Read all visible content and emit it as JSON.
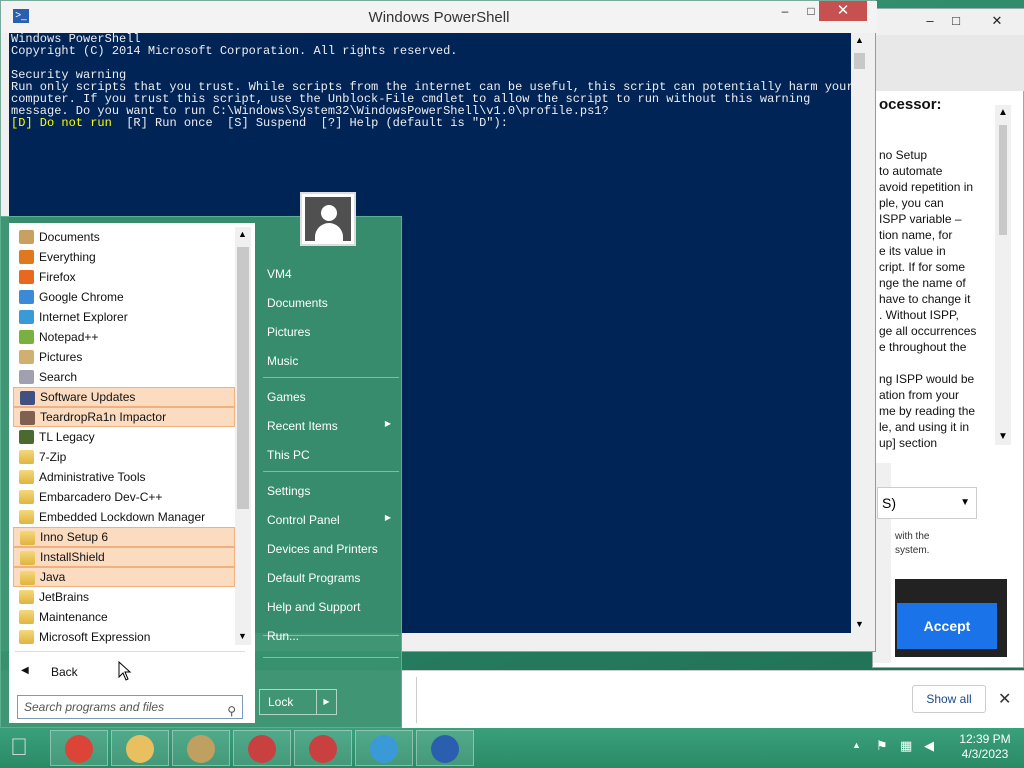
{
  "powershell": {
    "title": "Windows PowerShell",
    "icon": "powershell-icon",
    "lines": [
      "Windows PowerShell",
      "Copyright (C) 2014 Microsoft Corporation. All rights reserved.",
      "",
      "Security warning",
      "Run only scripts that you trust. While scripts from the internet can be useful, this script can potentially harm your",
      "computer. If you trust this script, use the Unblock-File cmdlet to allow the script to run without this warning",
      "message. Do you want to run C:\\Windows\\System32\\WindowsPowerShell\\v1.0\\profile.ps1?"
    ],
    "prompt_highlight": "[D] Do not run",
    "prompt_rest": "  [R] Run once  [S] Suspend  [?] Help (default is \"D\"):",
    "minimize": "–",
    "maximize": "□",
    "close": "✕"
  },
  "browser": {
    "minimize": "–",
    "maximize": "□",
    "close": "✕",
    "heading": "ocessor:",
    "article_lines": [
      "no Setup",
      "to automate",
      "avoid repetition in",
      "ple, you can",
      "ISPP variable –",
      "tion name, for",
      "e its value in",
      "cript. If for some",
      "nge the name of",
      "have to change it",
      ". Without ISPP,",
      "ge all occurrences",
      "e throughout the",
      "",
      "ng ISPP would be",
      "ation from your",
      "me by reading the",
      "le, and using it in",
      "up] section"
    ],
    "select_value": "S)",
    "small_text_1": "with the",
    "small_text_2": "system.",
    "accept_label": "Accept"
  },
  "download_bar": {
    "show_all": "Show all",
    "close": "✕"
  },
  "start_menu": {
    "programs": [
      {
        "label": "Documents",
        "icon": "documents-icon",
        "color": "#c8a060",
        "highlight": false
      },
      {
        "label": "Everything",
        "icon": "everything-icon",
        "color": "#e07820",
        "highlight": false
      },
      {
        "label": "Firefox",
        "icon": "firefox-icon",
        "color": "#e86820",
        "highlight": false
      },
      {
        "label": "Google Chrome",
        "icon": "chrome-icon",
        "color": "#3a8ad8",
        "highlight": false
      },
      {
        "label": "Internet Explorer",
        "icon": "ie-icon",
        "color": "#3a9ad8",
        "highlight": false
      },
      {
        "label": "Notepad++",
        "icon": "notepadpp-icon",
        "color": "#7ab040",
        "highlight": false
      },
      {
        "label": "Pictures",
        "icon": "pictures-icon",
        "color": "#d0b070",
        "highlight": false
      },
      {
        "label": "Search",
        "icon": "search-icon",
        "color": "#a0a0b0",
        "highlight": false
      },
      {
        "label": "Software Updates",
        "icon": "software-updates-icon",
        "color": "#405080",
        "highlight": true
      },
      {
        "label": "TeardropRa1n Impactor",
        "icon": "impactor-icon",
        "color": "#806050",
        "highlight": true
      },
      {
        "label": "TL Legacy",
        "icon": "tl-legacy-icon",
        "color": "#4a6a30",
        "highlight": false
      },
      {
        "label": "7-Zip",
        "icon": "folder-icon",
        "color": "folder",
        "highlight": false
      },
      {
        "label": "Administrative Tools",
        "icon": "folder-icon",
        "color": "folder",
        "highlight": false
      },
      {
        "label": "Embarcadero Dev-C++",
        "icon": "folder-icon",
        "color": "folder",
        "highlight": false
      },
      {
        "label": "Embedded Lockdown Manager",
        "icon": "folder-icon",
        "color": "folder",
        "highlight": false
      },
      {
        "label": "Inno Setup 6",
        "icon": "folder-icon",
        "color": "folder",
        "highlight": true
      },
      {
        "label": "InstallShield",
        "icon": "folder-icon",
        "color": "folder",
        "highlight": true
      },
      {
        "label": "Java",
        "icon": "folder-icon",
        "color": "folder",
        "highlight": true
      },
      {
        "label": "JetBrains",
        "icon": "folder-icon",
        "color": "folder",
        "highlight": false
      },
      {
        "label": "Maintenance",
        "icon": "folder-icon",
        "color": "folder",
        "highlight": false
      },
      {
        "label": "Microsoft Expression",
        "icon": "folder-icon",
        "color": "folder",
        "highlight": false
      }
    ],
    "back_label": "Back",
    "search_placeholder": "Search programs and files",
    "right_items": [
      {
        "label": "VM4",
        "arrow": false
      },
      {
        "label": "Documents",
        "arrow": false
      },
      {
        "label": "Pictures",
        "arrow": false
      },
      {
        "label": "Music",
        "arrow": false
      },
      {
        "label": "Games",
        "arrow": false
      },
      {
        "label": "Recent Items",
        "arrow": true
      },
      {
        "label": "This PC",
        "arrow": false
      },
      {
        "label": "Settings",
        "arrow": false
      },
      {
        "label": "Control Panel",
        "arrow": true
      },
      {
        "label": "Devices and Printers",
        "arrow": false
      },
      {
        "label": "Default Programs",
        "arrow": false
      },
      {
        "label": "Help and Support",
        "arrow": false
      },
      {
        "label": "Run...",
        "arrow": false
      }
    ],
    "lock_label": "Lock"
  },
  "taskbar": {
    "start_icon": "apple-start-icon",
    "items": [
      {
        "name": "chrome-taskbar-icon",
        "color": "#db4437"
      },
      {
        "name": "file-explorer-taskbar-icon",
        "color": "#e8c060"
      },
      {
        "name": "app-taskbar-icon",
        "color": "#c0a060"
      },
      {
        "name": "app-taskbar-icon-2",
        "color": "#c84040"
      },
      {
        "name": "app-taskbar-icon-3",
        "color": "#c84040"
      },
      {
        "name": "ie-taskbar-icon",
        "color": "#3a9ad8"
      },
      {
        "name": "powershell-taskbar-icon",
        "color": "#2a5fb0"
      }
    ],
    "time": "12:39 PM",
    "date": "4/3/2023"
  }
}
